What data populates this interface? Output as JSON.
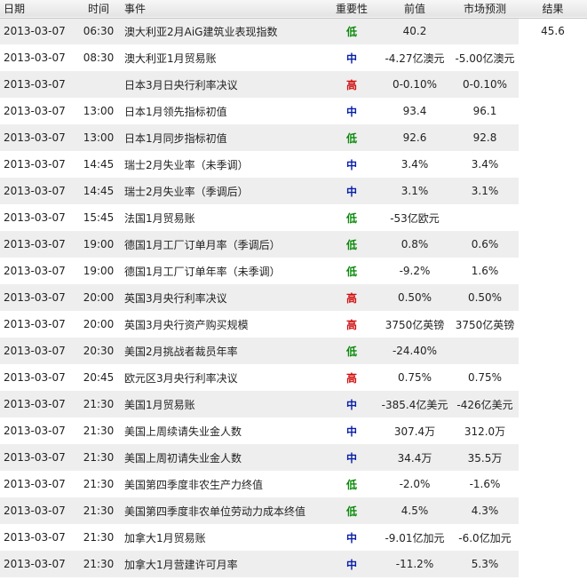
{
  "headers": {
    "date": "日期",
    "time": "时间",
    "event": "事件",
    "importance": "重要性",
    "previous": "前值",
    "forecast": "市场预测",
    "result": "结果"
  },
  "importance_colors": {
    "低": "#0b8a0b",
    "中": "#0a1fa8",
    "高": "#d01010"
  },
  "rows": [
    {
      "date": "2013-03-07",
      "time": "06:30",
      "event": "澳大利亚2月AiG建筑业表现指数",
      "importance": "低",
      "previous": "40.2",
      "forecast": "",
      "result": "45.6"
    },
    {
      "date": "2013-03-07",
      "time": "08:30",
      "event": "澳大利亚1月贸易账",
      "importance": "中",
      "previous": "-4.27亿澳元",
      "forecast": "-5.00亿澳元",
      "result": ""
    },
    {
      "date": "2013-03-07",
      "time": "",
      "event": "日本3月日央行利率决议",
      "importance": "高",
      "previous": "0-0.10%",
      "forecast": "0-0.10%",
      "result": ""
    },
    {
      "date": "2013-03-07",
      "time": "13:00",
      "event": "日本1月领先指标初值",
      "importance": "中",
      "previous": "93.4",
      "forecast": "96.1",
      "result": ""
    },
    {
      "date": "2013-03-07",
      "time": "13:00",
      "event": "日本1月同步指标初值",
      "importance": "低",
      "previous": "92.6",
      "forecast": "92.8",
      "result": ""
    },
    {
      "date": "2013-03-07",
      "time": "14:45",
      "event": "瑞士2月失业率（未季调）",
      "importance": "中",
      "previous": "3.4%",
      "forecast": "3.4%",
      "result": ""
    },
    {
      "date": "2013-03-07",
      "time": "14:45",
      "event": "瑞士2月失业率（季调后）",
      "importance": "中",
      "previous": "3.1%",
      "forecast": "3.1%",
      "result": ""
    },
    {
      "date": "2013-03-07",
      "time": "15:45",
      "event": "法国1月贸易账",
      "importance": "低",
      "previous": "-53亿欧元",
      "forecast": "",
      "result": ""
    },
    {
      "date": "2013-03-07",
      "time": "19:00",
      "event": "德国1月工厂订单月率（季调后）",
      "importance": "低",
      "previous": "0.8%",
      "forecast": "0.6%",
      "result": ""
    },
    {
      "date": "2013-03-07",
      "time": "19:00",
      "event": "德国1月工厂订单年率（未季调）",
      "importance": "低",
      "previous": "-9.2%",
      "forecast": "1.6%",
      "result": ""
    },
    {
      "date": "2013-03-07",
      "time": "20:00",
      "event": "英国3月央行利率决议",
      "importance": "高",
      "previous": "0.50%",
      "forecast": "0.50%",
      "result": ""
    },
    {
      "date": "2013-03-07",
      "time": "20:00",
      "event": "英国3月央行资产购买规模",
      "importance": "高",
      "previous": "3750亿英镑",
      "forecast": "3750亿英镑",
      "result": ""
    },
    {
      "date": "2013-03-07",
      "time": "20:30",
      "event": "美国2月挑战者裁员年率",
      "importance": "低",
      "previous": "-24.40%",
      "forecast": "",
      "result": ""
    },
    {
      "date": "2013-03-07",
      "time": "20:45",
      "event": "欧元区3月央行利率决议",
      "importance": "高",
      "previous": "0.75%",
      "forecast": "0.75%",
      "result": ""
    },
    {
      "date": "2013-03-07",
      "time": "21:30",
      "event": "美国1月贸易账",
      "importance": "中",
      "previous": "-385.4亿美元",
      "forecast": "-426亿美元",
      "result": ""
    },
    {
      "date": "2013-03-07",
      "time": "21:30",
      "event": "美国上周续请失业金人数",
      "importance": "中",
      "previous": "307.4万",
      "forecast": "312.0万",
      "result": ""
    },
    {
      "date": "2013-03-07",
      "time": "21:30",
      "event": "美国上周初请失业金人数",
      "importance": "中",
      "previous": "34.4万",
      "forecast": "35.5万",
      "result": ""
    },
    {
      "date": "2013-03-07",
      "time": "21:30",
      "event": "美国第四季度非农生产力终值",
      "importance": "低",
      "previous": "-2.0%",
      "forecast": "-1.6%",
      "result": ""
    },
    {
      "date": "2013-03-07",
      "time": "21:30",
      "event": "美国第四季度非农单位劳动力成本终值",
      "importance": "低",
      "previous": "4.5%",
      "forecast": "4.3%",
      "result": ""
    },
    {
      "date": "2013-03-07",
      "time": "21:30",
      "event": "加拿大1月贸易账",
      "importance": "中",
      "previous": "-9.01亿加元",
      "forecast": "-6.0亿加元",
      "result": ""
    },
    {
      "date": "2013-03-07",
      "time": "21:30",
      "event": "加拿大1月营建许可月率",
      "importance": "中",
      "previous": "-11.2%",
      "forecast": "5.3%",
      "result": ""
    }
  ]
}
